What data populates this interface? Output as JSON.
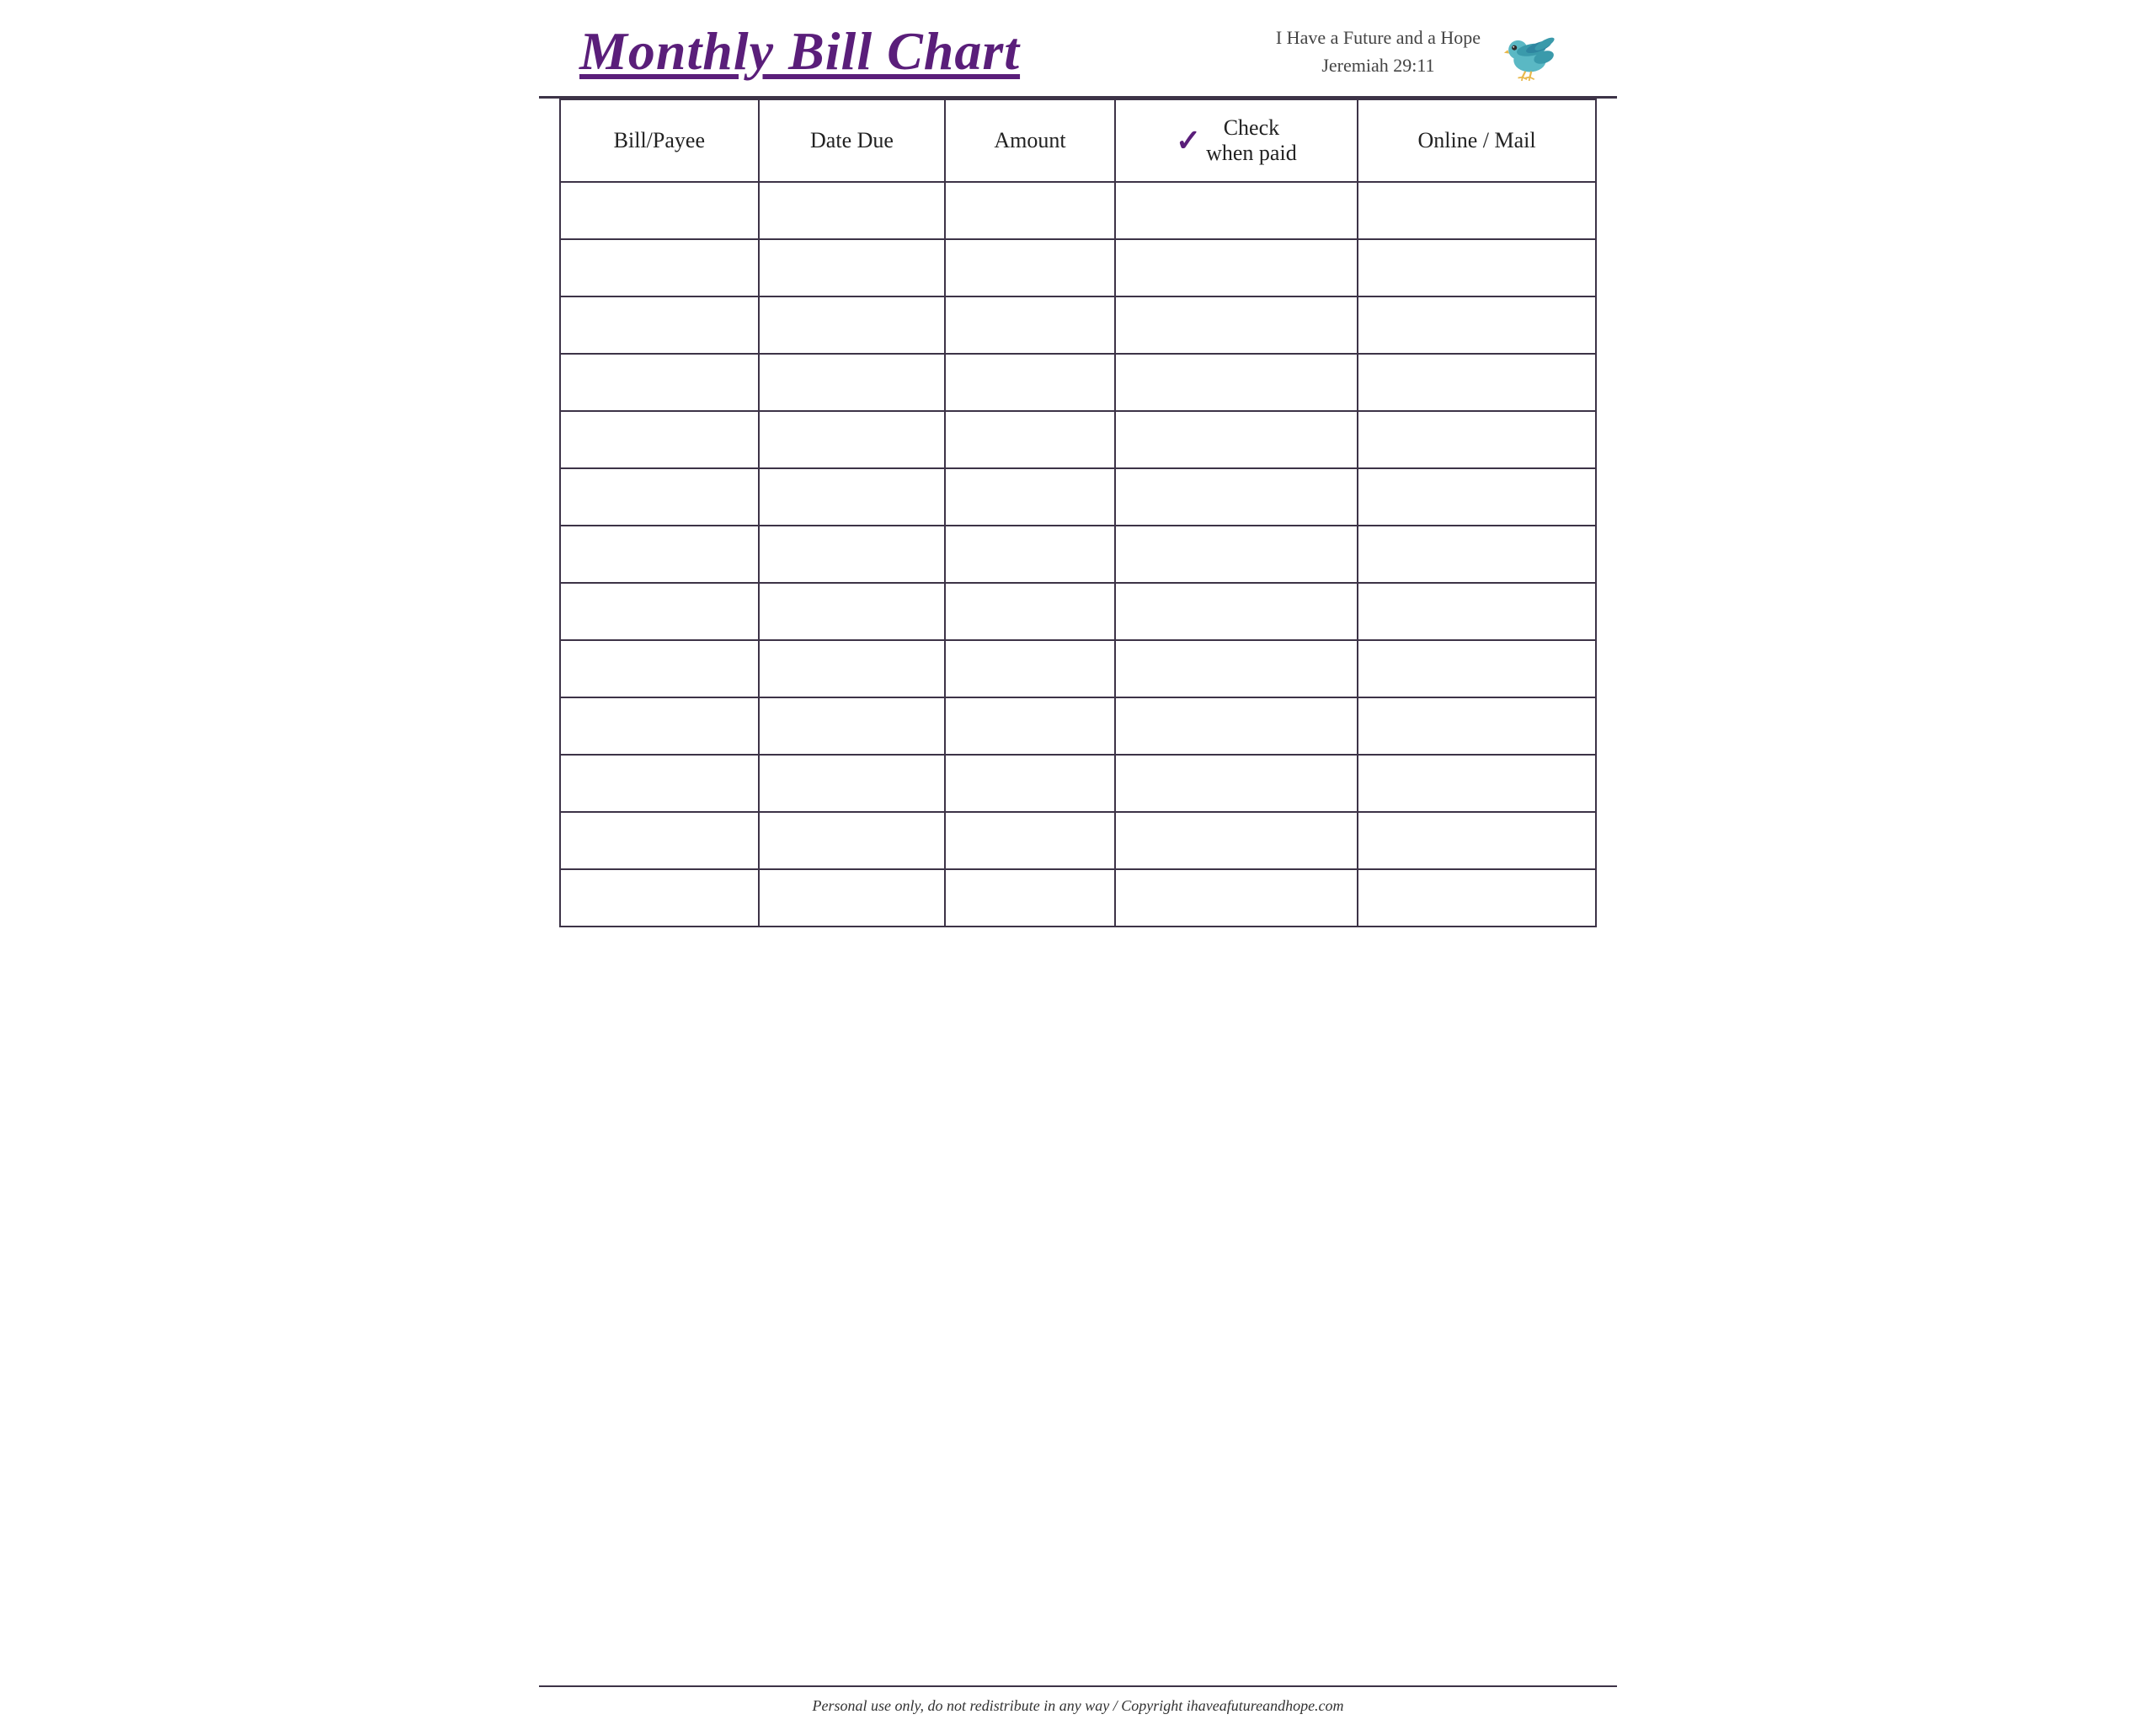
{
  "header": {
    "title": "Monthly Bill Chart",
    "tagline_line1": "I Have a Future and a Hope",
    "tagline_line2": "Jeremiah 29:11"
  },
  "table": {
    "columns": [
      {
        "key": "bill_payee",
        "label": "Bill/Payee"
      },
      {
        "key": "date_due",
        "label": "Date Due"
      },
      {
        "key": "amount",
        "label": "Amount"
      },
      {
        "key": "check_when_paid",
        "label_prefix": "Check",
        "label_suffix": "when paid"
      },
      {
        "key": "online_mail",
        "label": "Online / Mail"
      }
    ],
    "row_count": 13
  },
  "footer": {
    "text": "Personal use only, do not redistribute in any way / Copyright ihaveafutureandhope.com"
  }
}
